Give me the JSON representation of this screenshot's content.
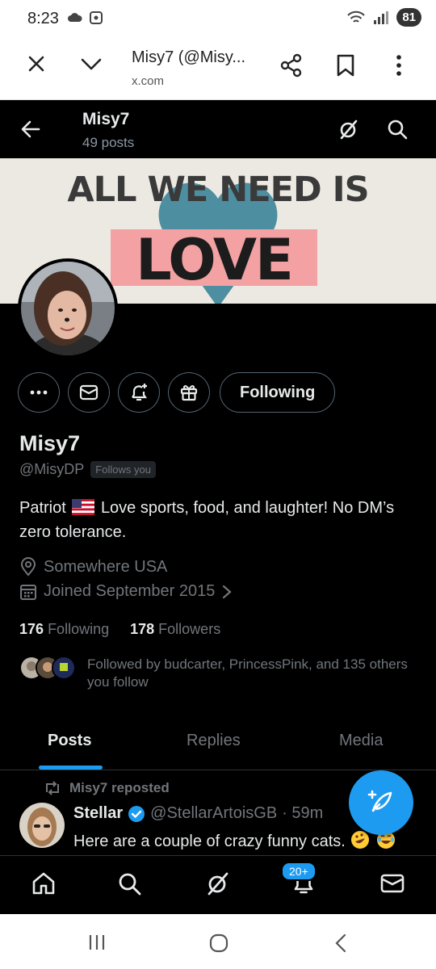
{
  "status_bar": {
    "time": "8:23",
    "battery": "81"
  },
  "browser": {
    "title": "Misy7 (@Misy...",
    "url": "x.com"
  },
  "header": {
    "name": "Misy7",
    "posts_count": "49 posts"
  },
  "banner": {
    "line1": "ALL WE NEED IS",
    "line2": "LOVE"
  },
  "profile": {
    "following_button": "Following",
    "name": "Misy7",
    "handle": "@MisyDP",
    "follows_you": "Follows you",
    "bio_prefix": "Patriot",
    "bio_rest": "Love sports, food, and laughter!  No DM’s zero tolerance.",
    "location": "Somewhere USA",
    "joined": "Joined September 2015",
    "following_count": "176",
    "following_label": "Following",
    "followers_count": "178",
    "followers_label": "Followers",
    "followed_by": "Followed by budcarter, PrincessPink, and 135 others you follow"
  },
  "tabs": [
    {
      "label": "Posts"
    },
    {
      "label": "Replies"
    },
    {
      "label": "Media"
    }
  ],
  "post": {
    "repost_label": "Misy7 reposted",
    "author": "Stellar",
    "handle": "@StellarArtoisGB",
    "time": "· 59m",
    "text": "Here are a couple of crazy funny cats."
  },
  "bottom_nav": {
    "notifications_badge": "20+"
  },
  "colors": {
    "accent": "#1d9bf0",
    "background": "#000000",
    "muted": "#71767b",
    "text": "#e7e9ea"
  },
  "icons": [
    "close-icon",
    "chevron-down-icon",
    "share-icon",
    "bookmark-icon",
    "more-vert-icon",
    "back-arrow-icon",
    "grok-icon",
    "search-icon",
    "more-icon",
    "mail-icon",
    "notify-add-icon",
    "gift-icon",
    "location-icon",
    "calendar-icon",
    "repost-icon",
    "verified-icon",
    "compose-icon",
    "home-icon",
    "bell-icon"
  ]
}
